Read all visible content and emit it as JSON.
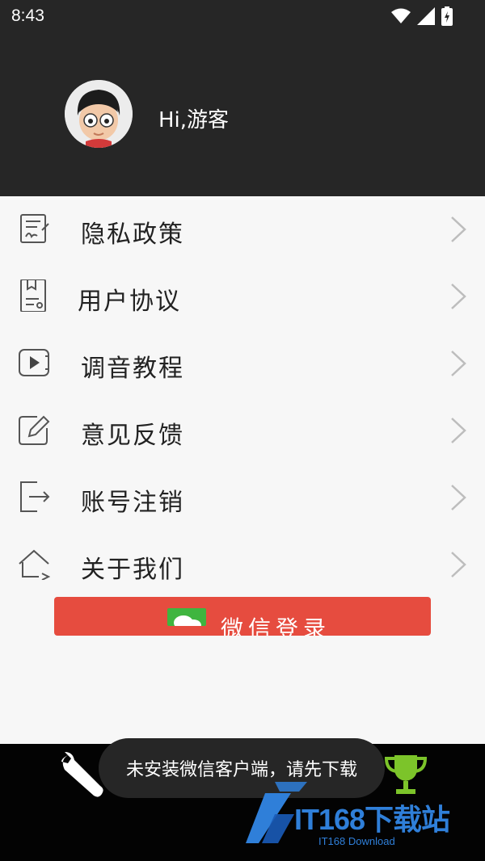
{
  "status_bar": {
    "time": "8:43"
  },
  "profile": {
    "greeting": "Hi,游客"
  },
  "menu": [
    {
      "label": "隐私政策",
      "icon": "document-sign-icon"
    },
    {
      "label": "用户协议",
      "icon": "agreement-icon"
    },
    {
      "label": "调音教程",
      "icon": "video-play-icon"
    },
    {
      "label": "意见反馈",
      "icon": "edit-pencil-icon"
    },
    {
      "label": "账号注销",
      "icon": "logout-icon"
    },
    {
      "label": "关于我们",
      "icon": "home-arrow-icon"
    }
  ],
  "wechat_button": {
    "label": "微信登录",
    "color": "#e64c3f"
  },
  "toast": {
    "message": "未安装微信客户端，请先下载"
  },
  "watermark": {
    "title": "IT168下载站",
    "subtitle": "IT168 Download"
  }
}
